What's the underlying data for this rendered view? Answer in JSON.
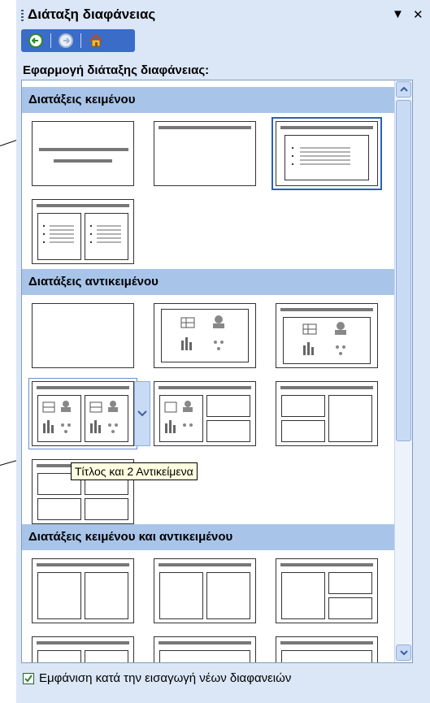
{
  "pane": {
    "title": "Διάταξη διαφάνειας",
    "menu_glyph": "▼",
    "close_glyph": "✕"
  },
  "nav": {
    "back_icon": "back-arrow-icon",
    "forward_icon": "forward-arrow-icon",
    "home_icon": "home-icon"
  },
  "apply_label": "Εφαρμογή διάταξης διαφάνειας:",
  "sections": {
    "text": "Διατάξεις κειμένου",
    "object": "Διατάξεις αντικειμένου",
    "text_object": "Διατάξεις κειμένου και αντικειμένου"
  },
  "tooltip": "Τίτλος και 2 Αντικείμενα",
  "show_on_insert": {
    "label": "Εμφάνιση κατά την εισαγωγή νέων διαφανειών",
    "checked": true
  },
  "colors": {
    "accent": "#3a6cc8",
    "section_header": "#a9c4e9",
    "checkbox": "#2a8a2a"
  }
}
